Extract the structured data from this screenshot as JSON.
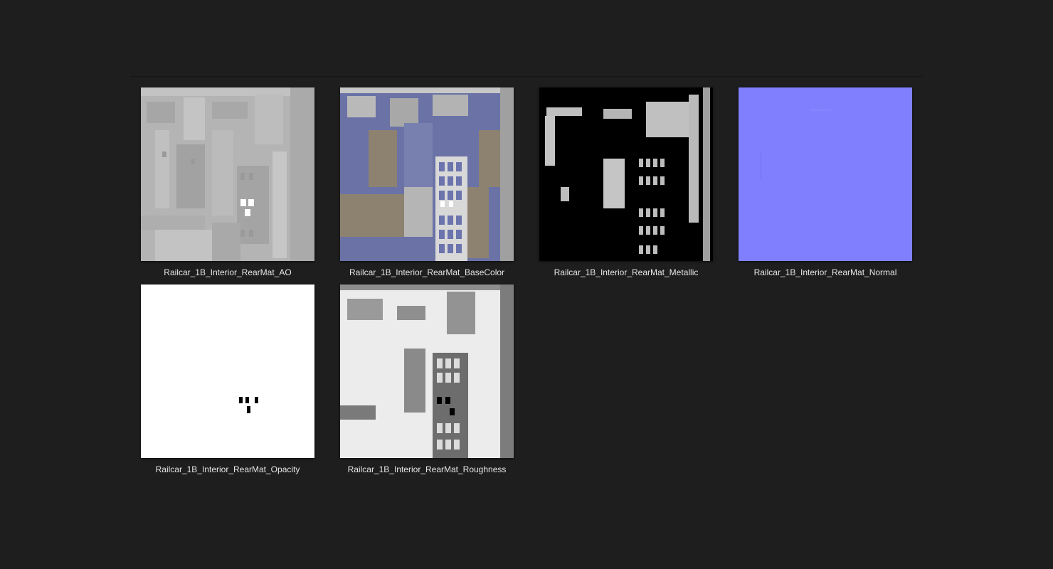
{
  "files": [
    {
      "name": "Railcar_1B_Interior_RearMat_AO",
      "preview": "ao"
    },
    {
      "name": "Railcar_1B_Interior_RearMat_BaseColor",
      "preview": "basecolor"
    },
    {
      "name": "Railcar_1B_Interior_RearMat_Metallic",
      "preview": "metallic"
    },
    {
      "name": "Railcar_1B_Interior_RearMat_Normal",
      "preview": "normal"
    },
    {
      "name": "Railcar_1B_Interior_RearMat_Opacity",
      "preview": "opacity"
    },
    {
      "name": "Railcar_1B_Interior_RearMat_Roughness",
      "preview": "roughness"
    }
  ],
  "colors": {
    "background": "#1e1e1e",
    "label": "#e6e6e6",
    "normal_map": "#8080ff",
    "basecolor_blue": "#6a72a6",
    "basecolor_tan": "#8d8270"
  }
}
